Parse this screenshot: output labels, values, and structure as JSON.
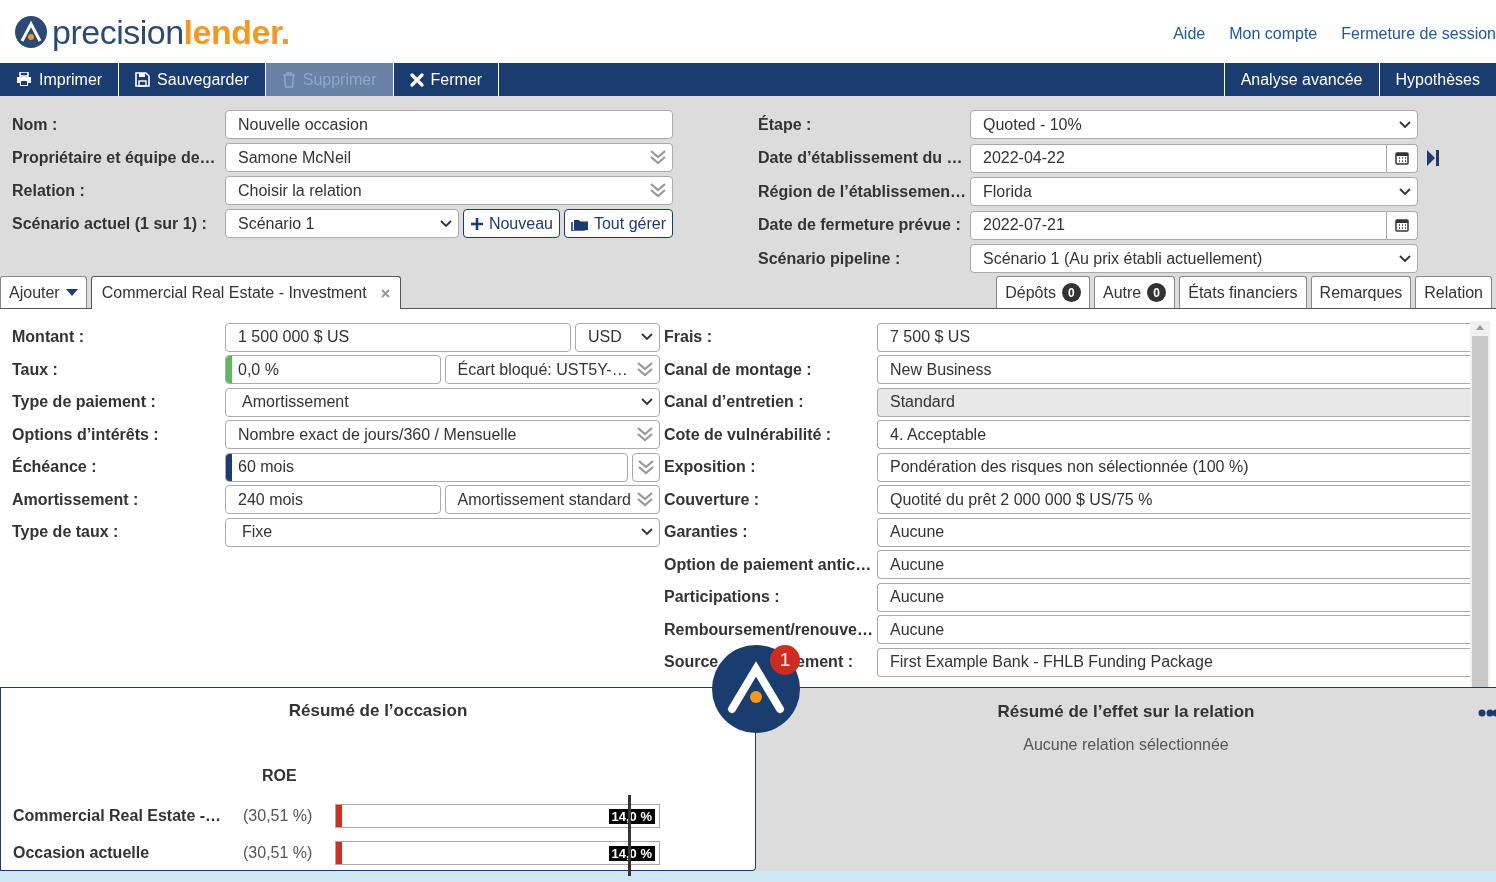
{
  "logo": {
    "primary": "precision",
    "accent": "lender."
  },
  "top_links": [
    "Aide",
    "Mon compte",
    "Fermeture de session"
  ],
  "toolbar": {
    "actions": [
      {
        "label": "Imprimer",
        "disabled": false
      },
      {
        "label": "Sauvegarder",
        "disabled": false
      },
      {
        "label": "Supprimer",
        "disabled": true
      },
      {
        "label": "Fermer",
        "disabled": false
      }
    ],
    "views": [
      "Analyse avancée",
      "Hypothèses"
    ]
  },
  "header_left": [
    {
      "label": "Nom :",
      "kind": "text",
      "value": "Nouvelle occasion"
    },
    {
      "label": "Propriétaire et équipe de…",
      "kind": "combo",
      "value": "Samone McNeil"
    },
    {
      "label": "Relation :",
      "kind": "combo",
      "value": "Choisir la relation"
    },
    {
      "label": "Scénario actuel (1 sur 1) :",
      "kind": "select",
      "value": "Scénario 1",
      "buttons": [
        {
          "label": "Nouveau"
        },
        {
          "label": "Tout gérer"
        }
      ]
    }
  ],
  "header_right": [
    {
      "label": "Étape :",
      "kind": "select",
      "value": "Quoted - 10%"
    },
    {
      "label": "Date d’établissement du …",
      "kind": "date",
      "value": "2022-04-22",
      "jump": true
    },
    {
      "label": "Région de l’établissemen…",
      "kind": "select",
      "value": "Florida"
    },
    {
      "label": "Date de fermeture prévue :",
      "kind": "date",
      "value": "2022-07-21"
    },
    {
      "label": "Scénario pipeline :",
      "kind": "select",
      "value": "Scénario 1 (Au prix établi actuellement)"
    }
  ],
  "product_tabs": {
    "add": "Ajouter",
    "tabs": [
      {
        "label": "Commercial Real Estate - Investment",
        "selected": true
      }
    ]
  },
  "side_tabs": [
    {
      "label": "Dépôts",
      "count": "0"
    },
    {
      "label": "Autre",
      "count": "0"
    },
    {
      "label": "États financiers"
    },
    {
      "label": "Remarques"
    },
    {
      "label": "Relation"
    }
  ],
  "loan_left": [
    {
      "label": "Montant :",
      "parts": [
        {
          "kind": "text",
          "value": "1 500 000 $ US"
        },
        {
          "kind": "select",
          "value": "USD"
        }
      ]
    },
    {
      "label": "Taux :",
      "parts": [
        {
          "kind": "text",
          "value": "0,0 %",
          "color": "#5cb85c"
        },
        {
          "kind": "combo",
          "value": "Écart bloqué: UST5Y-…"
        }
      ]
    },
    {
      "label": "Type de paiement :",
      "parts": [
        {
          "kind": "select",
          "value": "Amortissement"
        }
      ]
    },
    {
      "label": "Options d’intérêts :",
      "parts": [
        {
          "kind": "combo",
          "value": "Nombre exact de jours/360 / Mensuelle"
        }
      ]
    },
    {
      "label": "Échéance :",
      "parts": [
        {
          "kind": "text",
          "value": "60 mois",
          "color": "#1b3c6e"
        },
        {
          "kind": "combo_button"
        }
      ]
    },
    {
      "label": "Amortissement :",
      "parts": [
        {
          "kind": "text",
          "value": "240 mois"
        },
        {
          "kind": "combo",
          "value": "Amortissement standard"
        }
      ]
    },
    {
      "label": "Type de taux :",
      "parts": [
        {
          "kind": "select",
          "value": "Fixe"
        }
      ]
    }
  ],
  "loan_right": [
    {
      "label": "Frais :",
      "value": "7 500 $ US",
      "disabled": false
    },
    {
      "label": "Canal de montage :",
      "value": "New Business",
      "disabled": false
    },
    {
      "label": "Canal d’entretien :",
      "value": "Standard",
      "disabled": true
    },
    {
      "label": "Cote de vulnérabilité :",
      "value": "4. Acceptable",
      "disabled": false
    },
    {
      "label": "Exposition :",
      "value": "Pondération des risques non sélectionnée (100 %)",
      "disabled": false
    },
    {
      "label": "Couverture :",
      "value": "Quotité du prêt 2 000 000 $ US/75 %",
      "disabled": false
    },
    {
      "label": "Garanties :",
      "value": "Aucune",
      "disabled": false
    },
    {
      "label": "Option de paiement antic…",
      "value": "Aucune",
      "disabled": false
    },
    {
      "label": "Participations :",
      "value": "Aucune",
      "disabled": false
    },
    {
      "label": "Remboursement/renouve…",
      "value": "Aucune",
      "disabled": false
    },
    {
      "label": "Source",
      "label_tail": "ement :",
      "value": "First Example Bank - FHLB Funding Package",
      "disabled": false
    }
  ],
  "summary": {
    "title": "Résumé de l’occasion",
    "column": "ROE",
    "rows": [
      {
        "label": "Commercial Real Estate -…",
        "value": "(30,51 %)",
        "level": 0.02,
        "target": "14,0 %"
      },
      {
        "label": "Occasion actuelle",
        "value": "(30,51 %)",
        "level": 0.02,
        "target": "14,0 %"
      }
    ]
  },
  "relation_summary": {
    "title": "Résumé de l’effet sur la relation",
    "message": "Aucune relation sélectionnée"
  },
  "assistant": {
    "badge": "1"
  }
}
